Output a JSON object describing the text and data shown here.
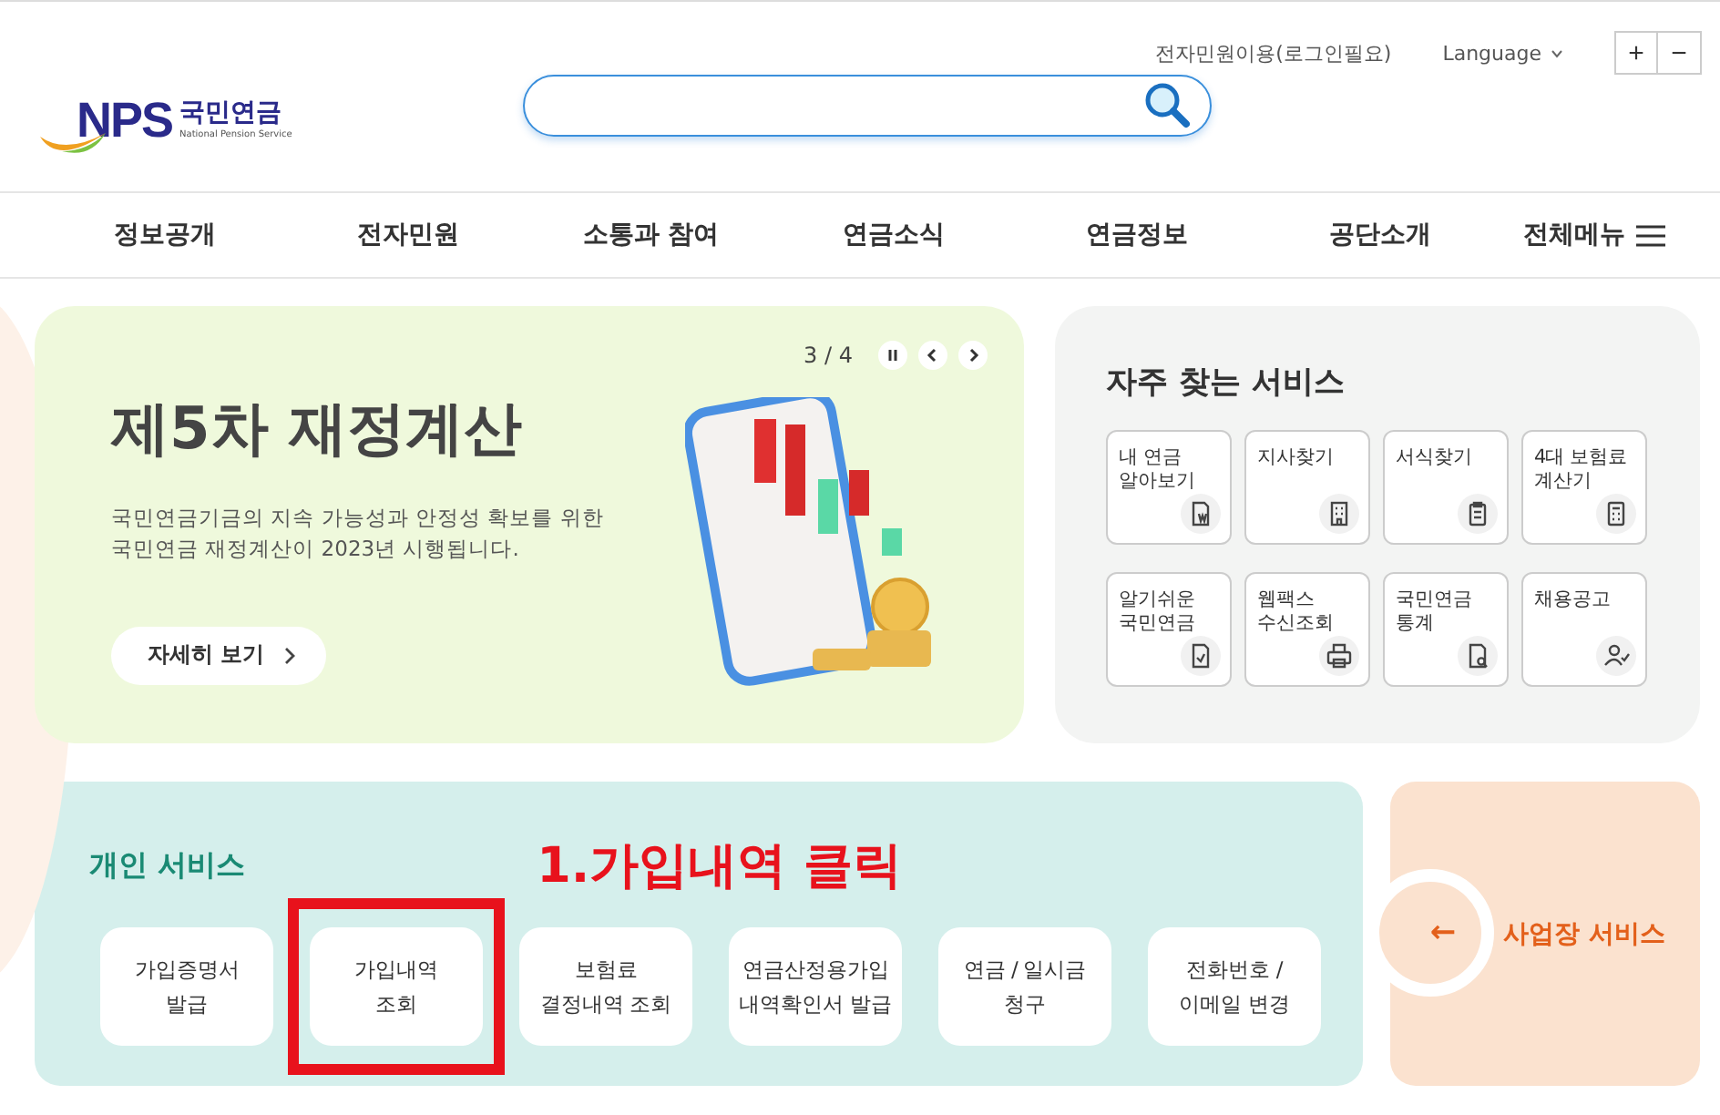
{
  "header": {
    "logo_mark": "NPS",
    "logo_name": "국민연금",
    "logo_sub": "National Pension Service",
    "utility_links": [
      "전자민원이용(로그인필요)"
    ],
    "language": "Language",
    "zoom_buttons": [
      "+",
      "−"
    ]
  },
  "nav": {
    "items": [
      "정보공개",
      "전자민원",
      "소통과 참여",
      "연금소식",
      "연금정보",
      "공단소개"
    ],
    "all_menu": "전체메뉴"
  },
  "banner": {
    "counter": "3 / 4",
    "title": "제5차 재정계산",
    "description": "국민연금기금의 지속 가능성과 안정성 확보를 위한\n국민연금 재정계산이 2023년 시행됩니다.",
    "button": "자세히 보기"
  },
  "quick_services": {
    "title": "자주 찾는 서비스",
    "items": [
      {
        "label": "내 연금\n알아보기",
        "kind": "doc-w"
      },
      {
        "label": "지사찾기",
        "kind": "building"
      },
      {
        "label": "서식찾기",
        "kind": "clipboard"
      },
      {
        "label": "4대 보험료\n계산기",
        "kind": "calculator"
      },
      {
        "label": "알기쉬운\n국민연금",
        "kind": "doc-check"
      },
      {
        "label": "웹팩스\n수신조회",
        "kind": "printer"
      },
      {
        "label": "국민연금\n통계",
        "kind": "doc-search"
      },
      {
        "label": "채용공고",
        "kind": "person"
      }
    ]
  },
  "personal_services": {
    "title": "개인 서비스",
    "items": [
      {
        "label": "가입증명서\n발급",
        "highlighted": false
      },
      {
        "label": "가입내역\n조회",
        "highlighted": true
      },
      {
        "label": "보험료\n결정내역 조회",
        "highlighted": false
      },
      {
        "label": "연금산정용가입\n내역확인서 발급",
        "highlighted": false
      },
      {
        "label": "연금 / 일시금\n청구",
        "highlighted": false
      },
      {
        "label": "전화번호 /\n이메일 변경",
        "highlighted": false
      }
    ]
  },
  "annotation": "1.가입내역 클릭",
  "business_services": {
    "arrow": "←",
    "label": "사업장 서비스"
  }
}
